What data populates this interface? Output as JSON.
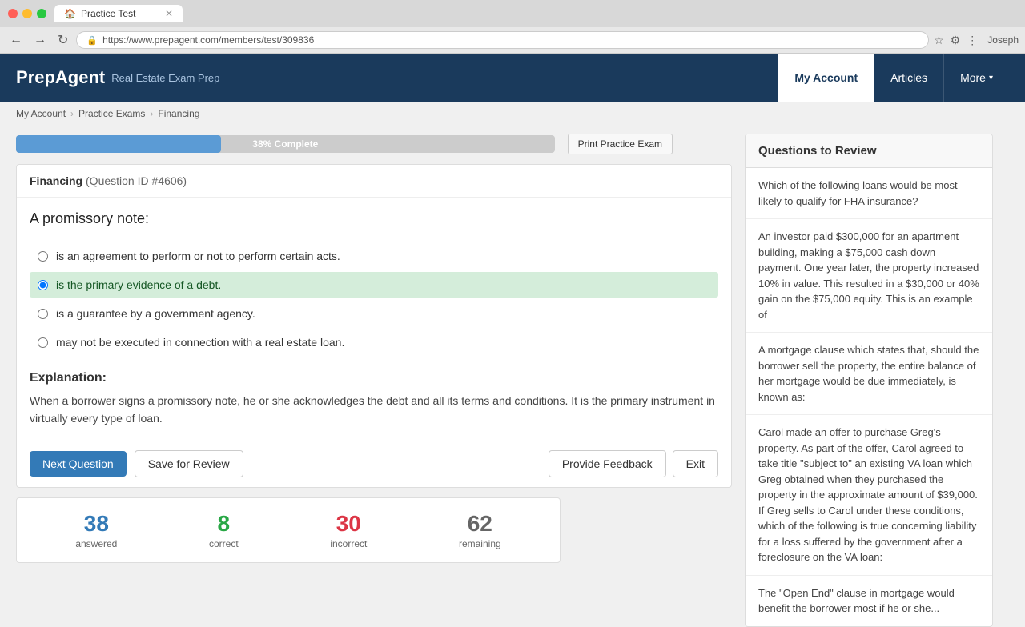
{
  "browser": {
    "tab_title": "Practice Test",
    "tab_favicon": "🏠",
    "address_bar": "https://www.prepagent.com/members/test/309836",
    "secure_label": "Secure",
    "user_label": "Joseph"
  },
  "header": {
    "logo_text": "PrepAgent",
    "tagline": "Real Estate Exam Prep",
    "nav_items": [
      {
        "label": "My Account",
        "active": true
      },
      {
        "label": "Articles",
        "active": false
      },
      {
        "label": "More",
        "active": false,
        "has_dropdown": true
      }
    ]
  },
  "breadcrumb": {
    "items": [
      "My Account",
      "Practice Exams",
      "Financing"
    ]
  },
  "progress": {
    "label": "38% Complete",
    "percent": 38
  },
  "print_btn": "Print Practice Exam",
  "question": {
    "category": "Financing",
    "question_id": "(Question ID #4606)",
    "question_text": "A promissory note:",
    "options": [
      {
        "text": "is an agreement to perform or not to perform certain acts.",
        "correct": false
      },
      {
        "text": "is the primary evidence of a debt.",
        "correct": true
      },
      {
        "text": "is a guarantee by a government agency.",
        "correct": false
      },
      {
        "text": "may not be executed in connection with a real estate loan.",
        "correct": false
      }
    ],
    "explanation_title": "Explanation:",
    "explanation_text": "When a borrower signs a promissory note, he or she acknowledges the debt and all its terms and conditions. It is the primary instrument in virtually every type of loan."
  },
  "action_buttons": {
    "next": "Next Question",
    "save": "Save for Review",
    "feedback": "Provide Feedback",
    "exit": "Exit"
  },
  "stats": {
    "answered": {
      "value": "38",
      "label": "answered"
    },
    "correct": {
      "value": "8",
      "label": "correct"
    },
    "incorrect": {
      "value": "30",
      "label": "incorrect"
    },
    "remaining": {
      "value": "62",
      "label": "remaining"
    }
  },
  "review_panel": {
    "title": "Questions to Review",
    "questions": [
      "Which of the following loans would be most likely to qualify for FHA insurance?",
      "An investor paid $300,000 for an apartment building, making a $75,000 cash down payment. One year later, the property increased 10% in value. This resulted in a $30,000 or 40% gain on the $75,000 equity. This is an example of",
      "A mortgage clause which states that, should the borrower sell the property, the entire balance of her mortgage would be due immediately, is known as:",
      "Carol made an offer to purchase Greg's property. As part of the offer, Carol agreed to take title \"subject to\" an existing VA loan which Greg obtained when they purchased the property in the approximate amount of $39,000. If Greg sells to Carol under these conditions, which of the following is true concerning liability for a loss suffered by the government after a foreclosure on the VA loan:",
      "The \"Open End\" clause in mortgage would benefit the borrower most if he or she..."
    ]
  }
}
